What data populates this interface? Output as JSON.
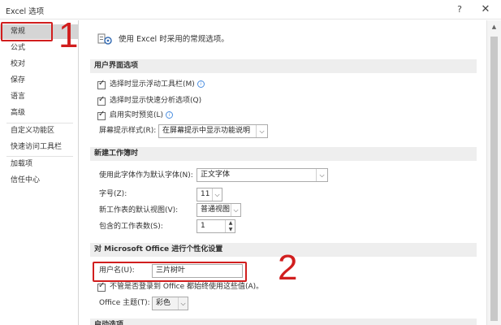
{
  "window": {
    "title": "Excel 选项",
    "help_icon": "?",
    "close_icon": "✕"
  },
  "sidebar": {
    "items": [
      {
        "label": "常规",
        "selected": true
      },
      {
        "label": "公式"
      },
      {
        "label": "校对"
      },
      {
        "label": "保存"
      },
      {
        "label": "语言"
      },
      {
        "label": "高级"
      },
      {
        "label": "自定义功能区"
      },
      {
        "label": "快速访问工具栏"
      },
      {
        "label": "加载项"
      },
      {
        "label": "信任中心"
      }
    ]
  },
  "annotations": {
    "marker_1": "1",
    "marker_2": "2",
    "color": "#d11e1e"
  },
  "main": {
    "intro": "使用 Excel 时采用的常规选项。",
    "ui_options": {
      "header": "用户界面选项",
      "mini_toolbar": "选择时显示浮动工具栏(M)",
      "quick_analysis": "选择时显示快速分析选项(Q)",
      "live_preview": "启用实时预览(L)",
      "screentip_label": "屏幕提示样式(R):",
      "screentip_value": "在屏幕提示中显示功能说明"
    },
    "new_workbook": {
      "header": "新建工作簿时",
      "font_label": "使用此字体作为默认字体(N):",
      "font_value": "正文字体",
      "size_label": "字号(Z):",
      "size_value": "11",
      "view_label": "新工作表的默认视图(V):",
      "view_value": "普通视图",
      "sheets_label": "包含的工作表数(S):",
      "sheets_value": "1"
    },
    "personalize": {
      "header": "对 Microsoft Office 进行个性化设置",
      "username_label": "用户名(U):",
      "username_value": "三片树叶",
      "always_use": "不管是否登录到 Office 都始终使用这些值(A)。",
      "theme_label": "Office 主题(T):",
      "theme_value": "彩色"
    },
    "startup": {
      "header": "启动选项"
    }
  },
  "icons": {
    "info": "i",
    "dropdown": "⌵",
    "spin_up": "▲",
    "spin_down": "▼",
    "scroll_up": "▲"
  }
}
